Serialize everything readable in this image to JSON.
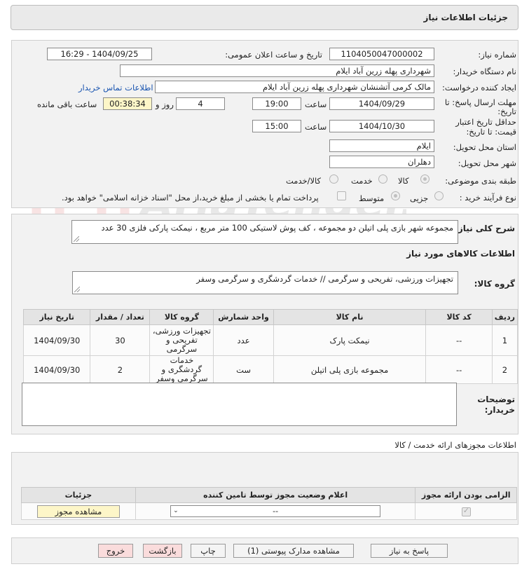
{
  "window": {
    "title": "جزئیات اطلاعات نیاز"
  },
  "watermark": {
    "text": "AriaTender.neT"
  },
  "form": {
    "need_number": {
      "label": "شماره نیاز:",
      "value": "1104050047000002"
    },
    "announce": {
      "label": "تاریخ و ساعت اعلان عمومی:",
      "value": "1404/09/25 - 16:29"
    },
    "buyer_org": {
      "label": "نام دستگاه خریدار:",
      "value": "شهرداری پهله زرین آباد ایلام"
    },
    "requester": {
      "label": "ایجاد کننده درخواست:",
      "value": "مالک کرمی آتشنشان شهرداری پهله زرین آباد ایلام",
      "contact_link": "اطلاعات تماس خریدار"
    },
    "deadline": {
      "label_line1": "مهلت ارسال پاسخ: تا",
      "label_line2": "تاریخ:",
      "date": "1404/09/29",
      "time_label": "ساعت",
      "time": "19:00",
      "days": "4",
      "days_label": "روز و",
      "remaining": "00:38:34",
      "remaining_label": "ساعت باقی مانده"
    },
    "validity": {
      "label_line1": "حداقل تاریخ اعتبار",
      "label_line2": "قیمت: تا تاریخ:",
      "date": "1404/10/30",
      "time_label": "ساعت",
      "time": "15:00"
    },
    "province": {
      "label": "استان محل تحویل:",
      "value": "ایلام"
    },
    "city": {
      "label": "شهر محل تحویل:",
      "value": "دهلران"
    },
    "category": {
      "label": "طبقه بندی موضوعی:",
      "options": [
        {
          "label": "کالا",
          "selected": true
        },
        {
          "label": "خدمت",
          "selected": false
        },
        {
          "label": "کالا/خدمت",
          "selected": false
        }
      ]
    },
    "process": {
      "label": "نوع فرآیند خرید :",
      "options": [
        {
          "label": "جزیی",
          "selected": false
        },
        {
          "label": "متوسط",
          "selected": true
        }
      ],
      "treasury_note": "پرداخت تمام یا بخشی از مبلغ خرید،از محل \"اسناد خزانه اسلامی\" خواهد بود."
    }
  },
  "description": {
    "label": "شرح کلی نیاز:",
    "value": "مجموعه شهر بازی پلی اتیلن دو مجموعه ، کف پوش لاستیکی 100 متر مربع ، نیمکت پارکی فلزی 30 عدد"
  },
  "goods_section": {
    "title": "اطلاعات کالاهای مورد نیاز",
    "group_label": "گروه کالا:",
    "group_value": "تجهیزات ورزشی، تفریحی و سرگرمی // خدمات گردشگری و سرگرمی وسفر",
    "columns": [
      "ردیف",
      "کد کالا",
      "نام کالا",
      "واحد شمارش",
      "گروه کالا",
      "تعداد / مقدار",
      "تاریخ نیاز"
    ],
    "rows": [
      {
        "idx": "1",
        "code": "--",
        "name": "نیمکت پارک",
        "unit": "عدد",
        "group": "تجهیزات ورزشی، تفریحی و سرگرمی",
        "qty": "30",
        "date": "1404/09/30"
      },
      {
        "idx": "2",
        "code": "--",
        "name": "مجموعه بازی پلی اتیلن",
        "unit": "ست",
        "group": "خدمات گردشگری و سرگرمی وسفر",
        "qty": "2",
        "date": "1404/09/30"
      }
    ],
    "buyer_notes_line1": "توضیحات",
    "buyer_notes_line2": "خریدار:",
    "buyer_notes_value": ""
  },
  "permits": {
    "title": "اطلاعات مجوزهای ارائه خدمت / کالا",
    "columns": [
      "الزامی بودن ارائه مجوز",
      "اعلام وضعیت مجوز توسط تامین کننده",
      "جزئیات"
    ],
    "select_value": "--",
    "view_button": "مشاهده مجوز"
  },
  "footer": {
    "reply": "پاسخ به نیاز",
    "docs": "مشاهده مدارک پیوستی (1)",
    "print": "چاپ",
    "back": "بازگشت",
    "exit": "خروج"
  }
}
